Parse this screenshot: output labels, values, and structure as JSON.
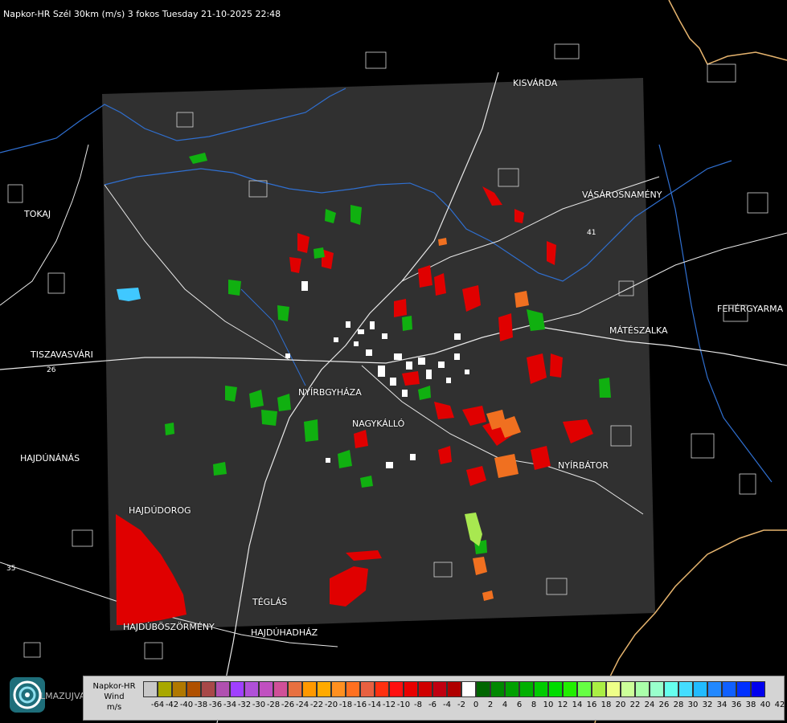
{
  "header": {
    "title": "Napkor-HR Szél 30km (m/s) 3 fokos Tuesday 21-10-2025 22:48"
  },
  "cities": {
    "kisvarda": "KISVÁRDA",
    "vasarosnameny": "VÁSÁROSNAMÉNY",
    "tokaj": "TOKAJ",
    "fehergyarmat": "FEHÉRGYARMA",
    "mateszalka": "MÁTÉSZALKA",
    "tiszavasvari": "TISZAVASVÁRI",
    "nyiregyhaza": "NYÍRBGYHÁZA",
    "nagykallo": "NAGYKÁLLÓ",
    "nyirbator": "NYÍRBÁTOR",
    "hajdunanas": "HAJDÚNÁNÁS",
    "hajdudorog": "HAJDÚDOROG",
    "teglas": "TÉGLÁS",
    "hajduboszormeny": "HAJDÚBÖSZÖRMÉNY",
    "hajduhadhaz": "HAJDÚHADHÁZ"
  },
  "road_labels": {
    "r26": "26",
    "r35": "35",
    "r41": "41"
  },
  "logo": {
    "text": "LMAZUJVAR"
  },
  "legend": {
    "title_line1": "Napkor-HR",
    "title_line2": "Wind",
    "title_line3": "m/s",
    "tick_labels": [
      "-64",
      "-42",
      "-40",
      "-38",
      "-36",
      "-34",
      "-32",
      "-30",
      "-28",
      "-26",
      "-24",
      "-22",
      "-20",
      "-18",
      "-16",
      "-14",
      "-12",
      "-10",
      "-8",
      "-6",
      "-4",
      "-2",
      "0",
      "2",
      "4",
      "6",
      "8",
      "10",
      "12",
      "14",
      "16",
      "18",
      "20",
      "22",
      "24",
      "26",
      "28",
      "30",
      "32",
      "34",
      "36",
      "38",
      "40",
      "42"
    ],
    "colors": [
      "#c8c8c8",
      "#a8a800",
      "#b07800",
      "#b05000",
      "#a84848",
      "#b050b0",
      "#a040ff",
      "#b050d8",
      "#c050c0",
      "#d05098",
      "#e87040",
      "#ff9900",
      "#ffaa00",
      "#ff9020",
      "#ff7020",
      "#e86040",
      "#ff3010",
      "#ff1010",
      "#e80000",
      "#d00000",
      "#c00010",
      "#b00000",
      "#ffffff",
      "#006600",
      "#008800",
      "#00a000",
      "#00b000",
      "#00cc00",
      "#00dd00",
      "#22ee00",
      "#66ff44",
      "#aaee44",
      "#eeff88",
      "#ccff99",
      "#aaffaa",
      "#99ffcc",
      "#66ffee",
      "#44ddff",
      "#22bbff",
      "#2288ff",
      "#1060ff",
      "#0030ff",
      "#0000ee"
    ]
  }
}
